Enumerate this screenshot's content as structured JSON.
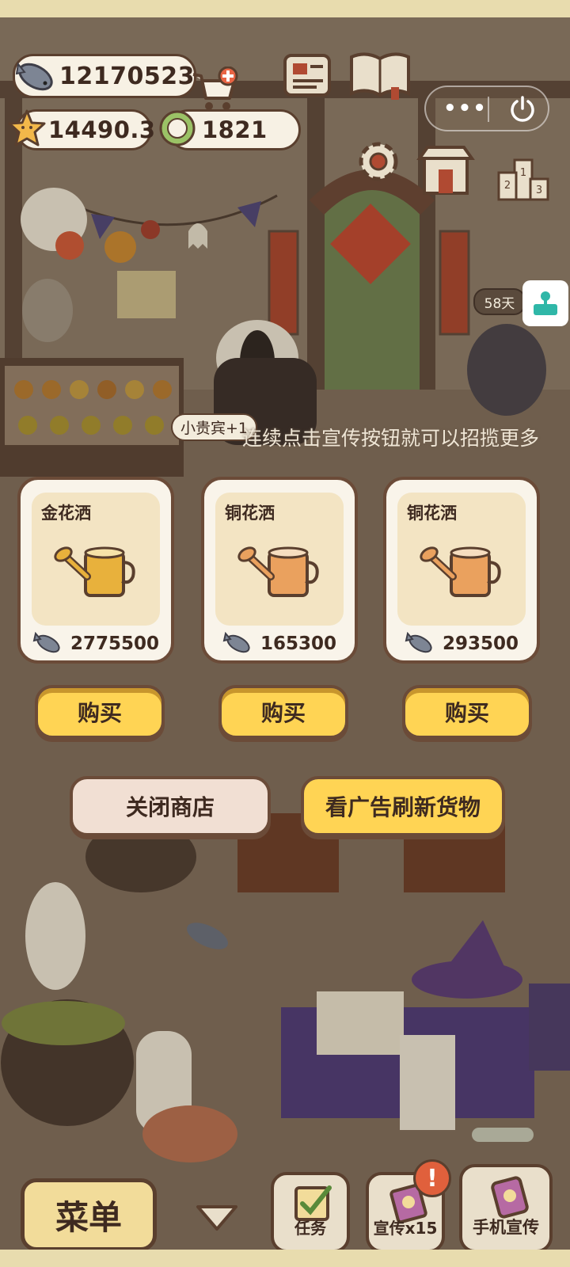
{
  "resources": {
    "fish_count": "12170523",
    "star_count": "14490.3",
    "coin_count": "1821"
  },
  "status": {
    "days_label": "58天",
    "npc_tag": "小贵宾+1",
    "marquee": "连续点击宣传按钮就可以招揽更多"
  },
  "shop": {
    "items": [
      {
        "name": "金花洒",
        "price": "2775500",
        "color": "#e8b13c",
        "buy_label": "购买"
      },
      {
        "name": "铜花洒",
        "price": "165300",
        "color": "#eaa15e",
        "buy_label": "购买"
      },
      {
        "name": "铜花洒",
        "price": "293500",
        "color": "#eaa15e",
        "buy_label": "购买"
      }
    ],
    "close_label": "关闭商店",
    "refresh_label": "看广告刷新货物"
  },
  "dock": {
    "menu_label": "菜单",
    "task_label": "任务",
    "promote_label": "宣传x15",
    "phone_promote_label": "手机宣传"
  },
  "colors": {
    "accent_yellow": "#ffd454",
    "outline_brown": "#6b4b38",
    "card_bg": "#f9f4ea",
    "close_btn_bg": "#f1dfd3"
  }
}
